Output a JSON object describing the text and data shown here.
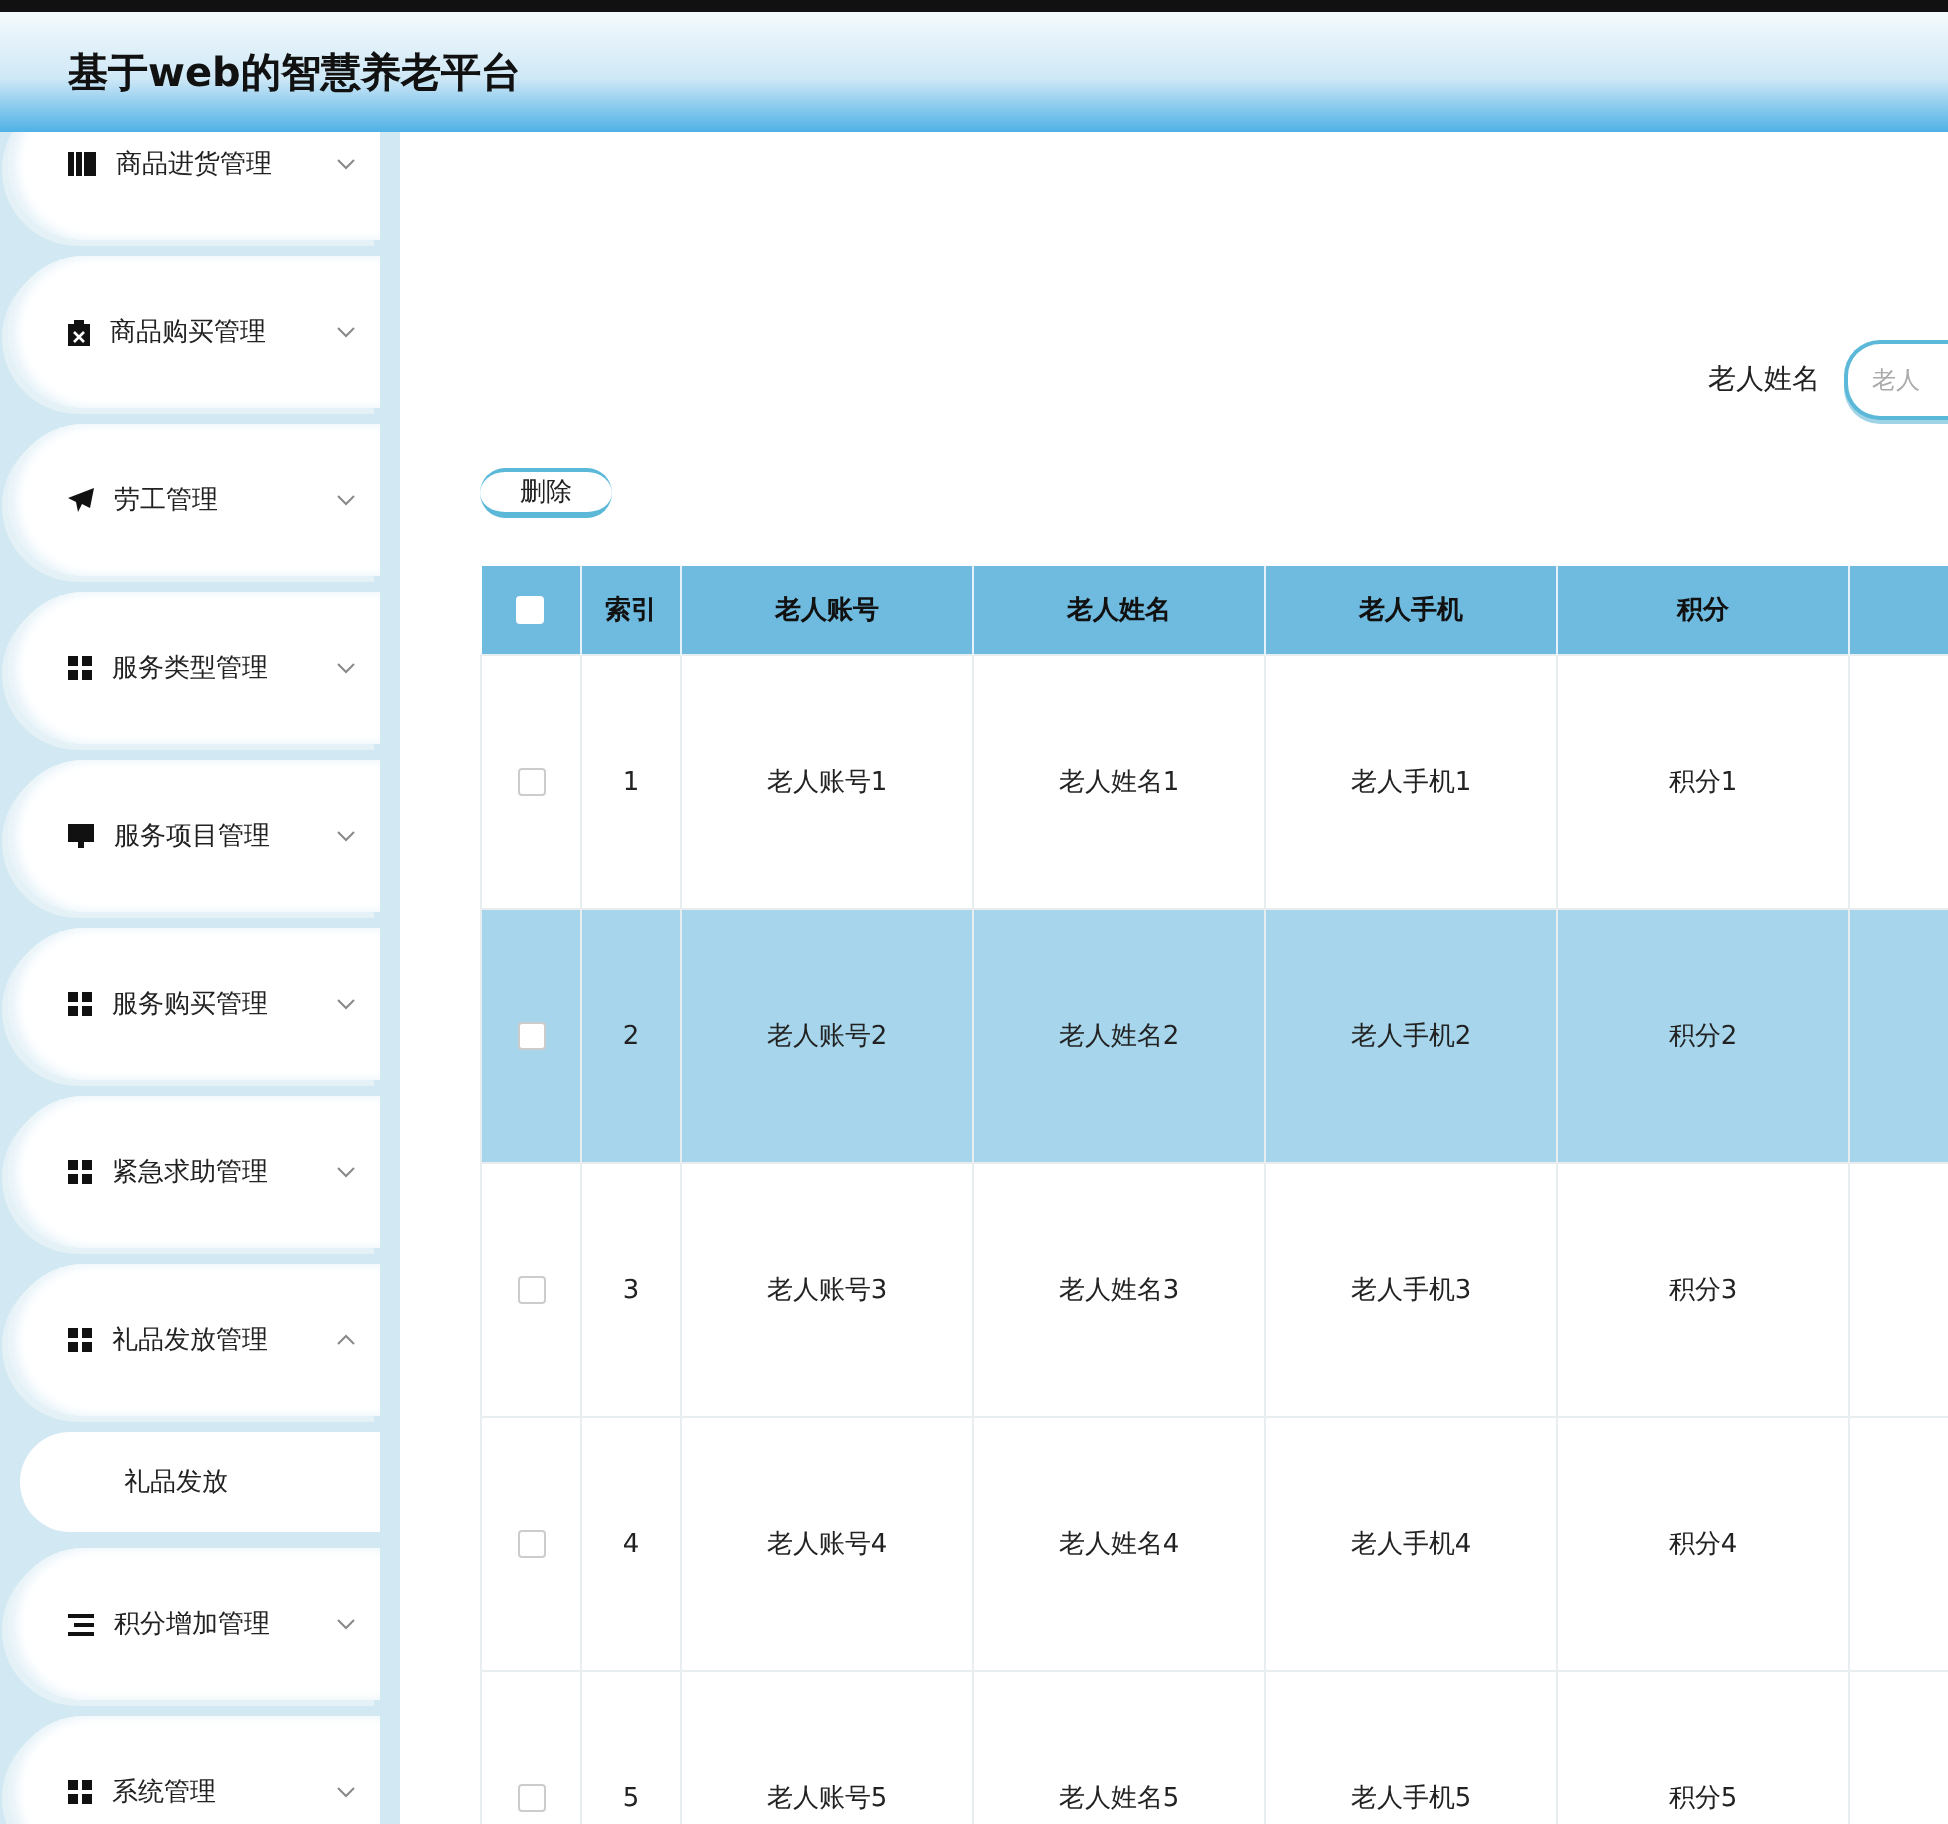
{
  "header": {
    "title": "基于web的智慧养老平台"
  },
  "sidebar": {
    "items": [
      {
        "label": "商品进货管理",
        "expanded": false
      },
      {
        "label": "商品购买管理",
        "expanded": false
      },
      {
        "label": "劳工管理",
        "expanded": false
      },
      {
        "label": "服务类型管理",
        "expanded": false
      },
      {
        "label": "服务项目管理",
        "expanded": false
      },
      {
        "label": "服务购买管理",
        "expanded": false
      },
      {
        "label": "紧急求助管理",
        "expanded": false
      },
      {
        "label": "礼品发放管理",
        "expanded": true,
        "children": [
          {
            "label": "礼品发放"
          }
        ]
      },
      {
        "label": "积分增加管理",
        "expanded": false
      },
      {
        "label": "系统管理",
        "expanded": false
      }
    ]
  },
  "search": {
    "label": "老人姓名",
    "placeholder": "老人"
  },
  "actions": [
    "删除"
  ],
  "table": {
    "select_all_checked": false,
    "columns": [
      "",
      "索引",
      "老人账号",
      "老人姓名",
      "老人手机",
      "积分",
      ""
    ],
    "rows": [
      {
        "checked": false,
        "selected": false,
        "cells": [
          "",
          "1",
          "老人账号1",
          "老人姓名1",
          "老人手机1",
          "积分1",
          ""
        ]
      },
      {
        "checked": false,
        "selected": true,
        "cells": [
          "",
          "2",
          "老人账号2",
          "老人姓名2",
          "老人手机2",
          "积分2",
          ""
        ]
      },
      {
        "checked": false,
        "selected": false,
        "cells": [
          "",
          "3",
          "老人账号3",
          "老人姓名3",
          "老人手机3",
          "积分3",
          ""
        ]
      },
      {
        "checked": false,
        "selected": false,
        "cells": [
          "",
          "4",
          "老人账号4",
          "老人姓名4",
          "老人手机4",
          "积分4",
          ""
        ]
      },
      {
        "checked": false,
        "selected": false,
        "cells": [
          "",
          "5",
          "老人账号5",
          "老人姓名5",
          "老人手机5",
          "积分5",
          ""
        ]
      }
    ]
  }
}
